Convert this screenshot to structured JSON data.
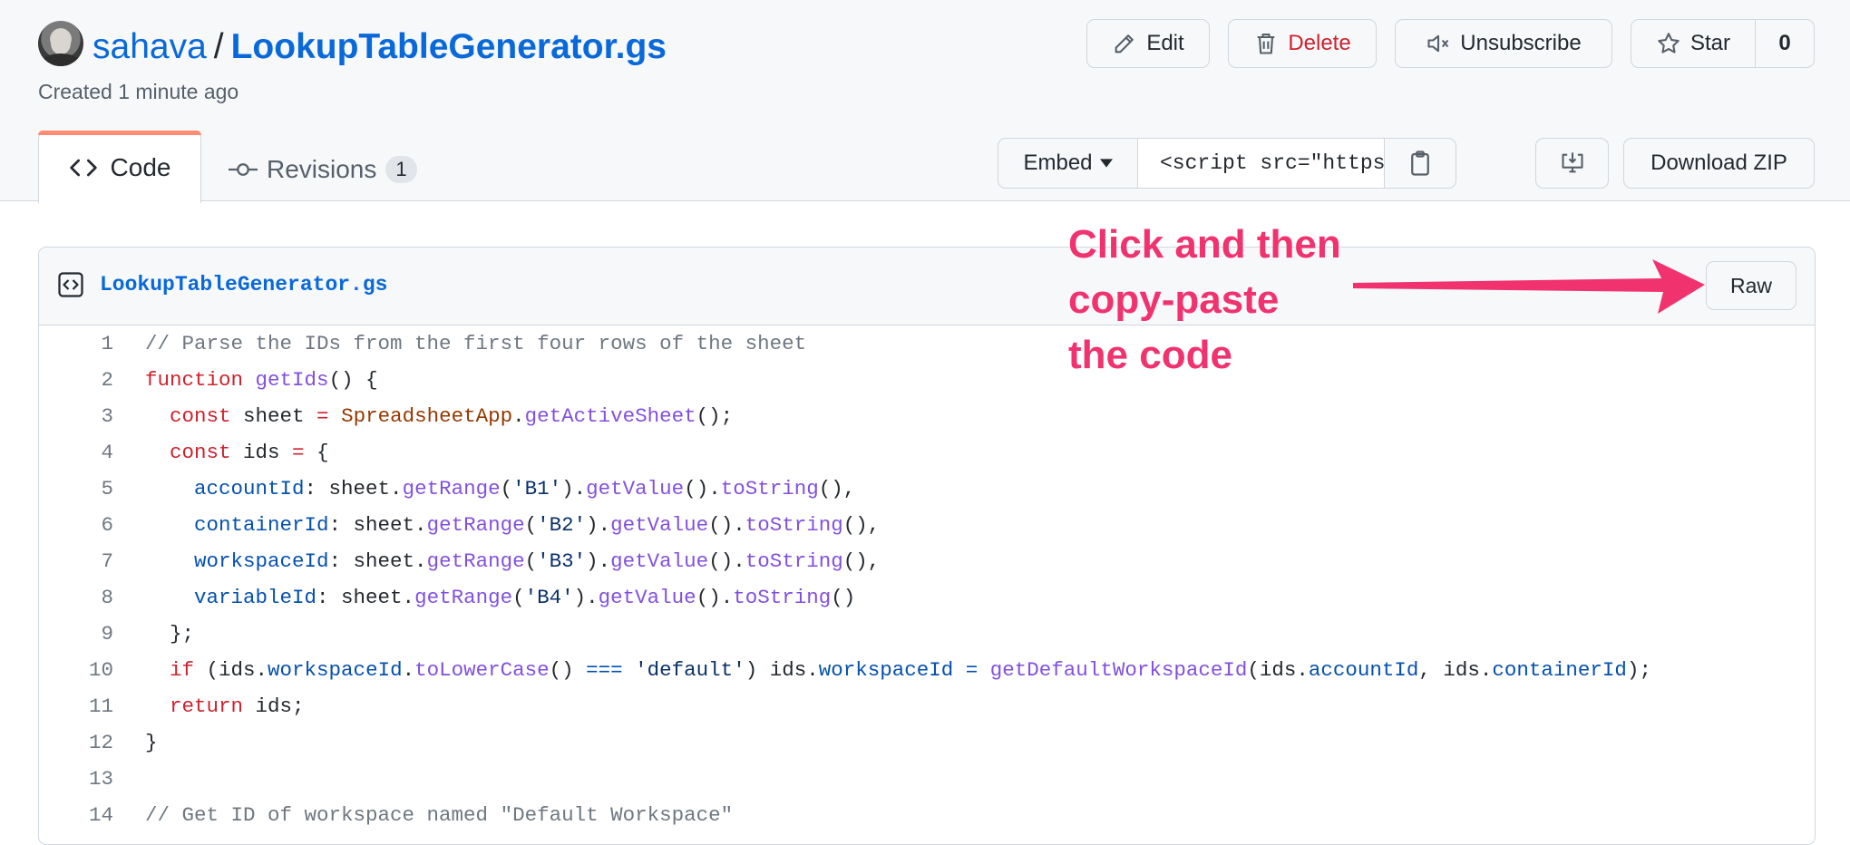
{
  "header": {
    "owner": "sahava",
    "separator": "/",
    "gist_name": "LookupTableGenerator.gs",
    "created": "Created 1 minute ago"
  },
  "actions": {
    "edit": "Edit",
    "delete": "Delete",
    "unsubscribe": "Unsubscribe",
    "star": "Star",
    "star_count": "0"
  },
  "tabs": {
    "code": "Code",
    "revisions": "Revisions",
    "revisions_count": "1"
  },
  "embed": {
    "select_label": "Embed",
    "value": "<script src=\"https://gi"
  },
  "download": "Download ZIP",
  "file": {
    "name": "LookupTableGenerator.gs",
    "raw_label": "Raw"
  },
  "code_lines": [
    [
      {
        "t": "// Parse the IDs from the first four rows of the sheet",
        "c": "c"
      }
    ],
    [
      {
        "t": "function",
        "c": "k"
      },
      {
        "t": " "
      },
      {
        "t": "getIds",
        "c": "f"
      },
      {
        "t": "() {"
      }
    ],
    [
      {
        "t": "  "
      },
      {
        "t": "const",
        "c": "k"
      },
      {
        "t": " sheet "
      },
      {
        "t": "=",
        "c": "k"
      },
      {
        "t": " "
      },
      {
        "t": "SpreadsheetApp",
        "c": "o"
      },
      {
        "t": "."
      },
      {
        "t": "getActiveSheet",
        "c": "f"
      },
      {
        "t": "();"
      }
    ],
    [
      {
        "t": "  "
      },
      {
        "t": "const",
        "c": "k"
      },
      {
        "t": " ids "
      },
      {
        "t": "=",
        "c": "k"
      },
      {
        "t": " {"
      }
    ],
    [
      {
        "t": "    "
      },
      {
        "t": "accountId",
        "c": "p"
      },
      {
        "t": ": sheet."
      },
      {
        "t": "getRange",
        "c": "f"
      },
      {
        "t": "("
      },
      {
        "t": "'B1'",
        "c": "s"
      },
      {
        "t": ")."
      },
      {
        "t": "getValue",
        "c": "f"
      },
      {
        "t": "()."
      },
      {
        "t": "toString",
        "c": "f"
      },
      {
        "t": "(),"
      }
    ],
    [
      {
        "t": "    "
      },
      {
        "t": "containerId",
        "c": "p"
      },
      {
        "t": ": sheet."
      },
      {
        "t": "getRange",
        "c": "f"
      },
      {
        "t": "("
      },
      {
        "t": "'B2'",
        "c": "s"
      },
      {
        "t": ")."
      },
      {
        "t": "getValue",
        "c": "f"
      },
      {
        "t": "()."
      },
      {
        "t": "toString",
        "c": "f"
      },
      {
        "t": "(),"
      }
    ],
    [
      {
        "t": "    "
      },
      {
        "t": "workspaceId",
        "c": "p"
      },
      {
        "t": ": sheet."
      },
      {
        "t": "getRange",
        "c": "f"
      },
      {
        "t": "("
      },
      {
        "t": "'B3'",
        "c": "s"
      },
      {
        "t": ")."
      },
      {
        "t": "getValue",
        "c": "f"
      },
      {
        "t": "()."
      },
      {
        "t": "toString",
        "c": "f"
      },
      {
        "t": "(),"
      }
    ],
    [
      {
        "t": "    "
      },
      {
        "t": "variableId",
        "c": "p"
      },
      {
        "t": ": sheet."
      },
      {
        "t": "getRange",
        "c": "f"
      },
      {
        "t": "("
      },
      {
        "t": "'B4'",
        "c": "s"
      },
      {
        "t": ")."
      },
      {
        "t": "getValue",
        "c": "f"
      },
      {
        "t": "()."
      },
      {
        "t": "toString",
        "c": "f"
      },
      {
        "t": "()"
      }
    ],
    [
      {
        "t": "  };"
      }
    ],
    [
      {
        "t": "  "
      },
      {
        "t": "if",
        "c": "k"
      },
      {
        "t": " (ids."
      },
      {
        "t": "workspaceId",
        "c": "p"
      },
      {
        "t": "."
      },
      {
        "t": "toLowerCase",
        "c": "f"
      },
      {
        "t": "() "
      },
      {
        "t": "===",
        "c": "p"
      },
      {
        "t": " "
      },
      {
        "t": "'default'",
        "c": "s"
      },
      {
        "t": ") ids."
      },
      {
        "t": "workspaceId",
        "c": "p"
      },
      {
        "t": " "
      },
      {
        "t": "=",
        "c": "p"
      },
      {
        "t": " "
      },
      {
        "t": "getDefaultWorkspaceId",
        "c": "f"
      },
      {
        "t": "(ids."
      },
      {
        "t": "accountId",
        "c": "p"
      },
      {
        "t": ", ids."
      },
      {
        "t": "containerId",
        "c": "p"
      },
      {
        "t": ");"
      }
    ],
    [
      {
        "t": "  "
      },
      {
        "t": "return",
        "c": "k"
      },
      {
        "t": " ids;"
      }
    ],
    [
      {
        "t": "}"
      }
    ],
    [
      {
        "t": ""
      }
    ],
    [
      {
        "t": "// Get ID of workspace named \"Default Workspace\"",
        "c": "c"
      }
    ]
  ],
  "annotation": {
    "lines": [
      "Click and then",
      "copy-paste",
      "the code"
    ],
    "color": "#f0336f"
  }
}
